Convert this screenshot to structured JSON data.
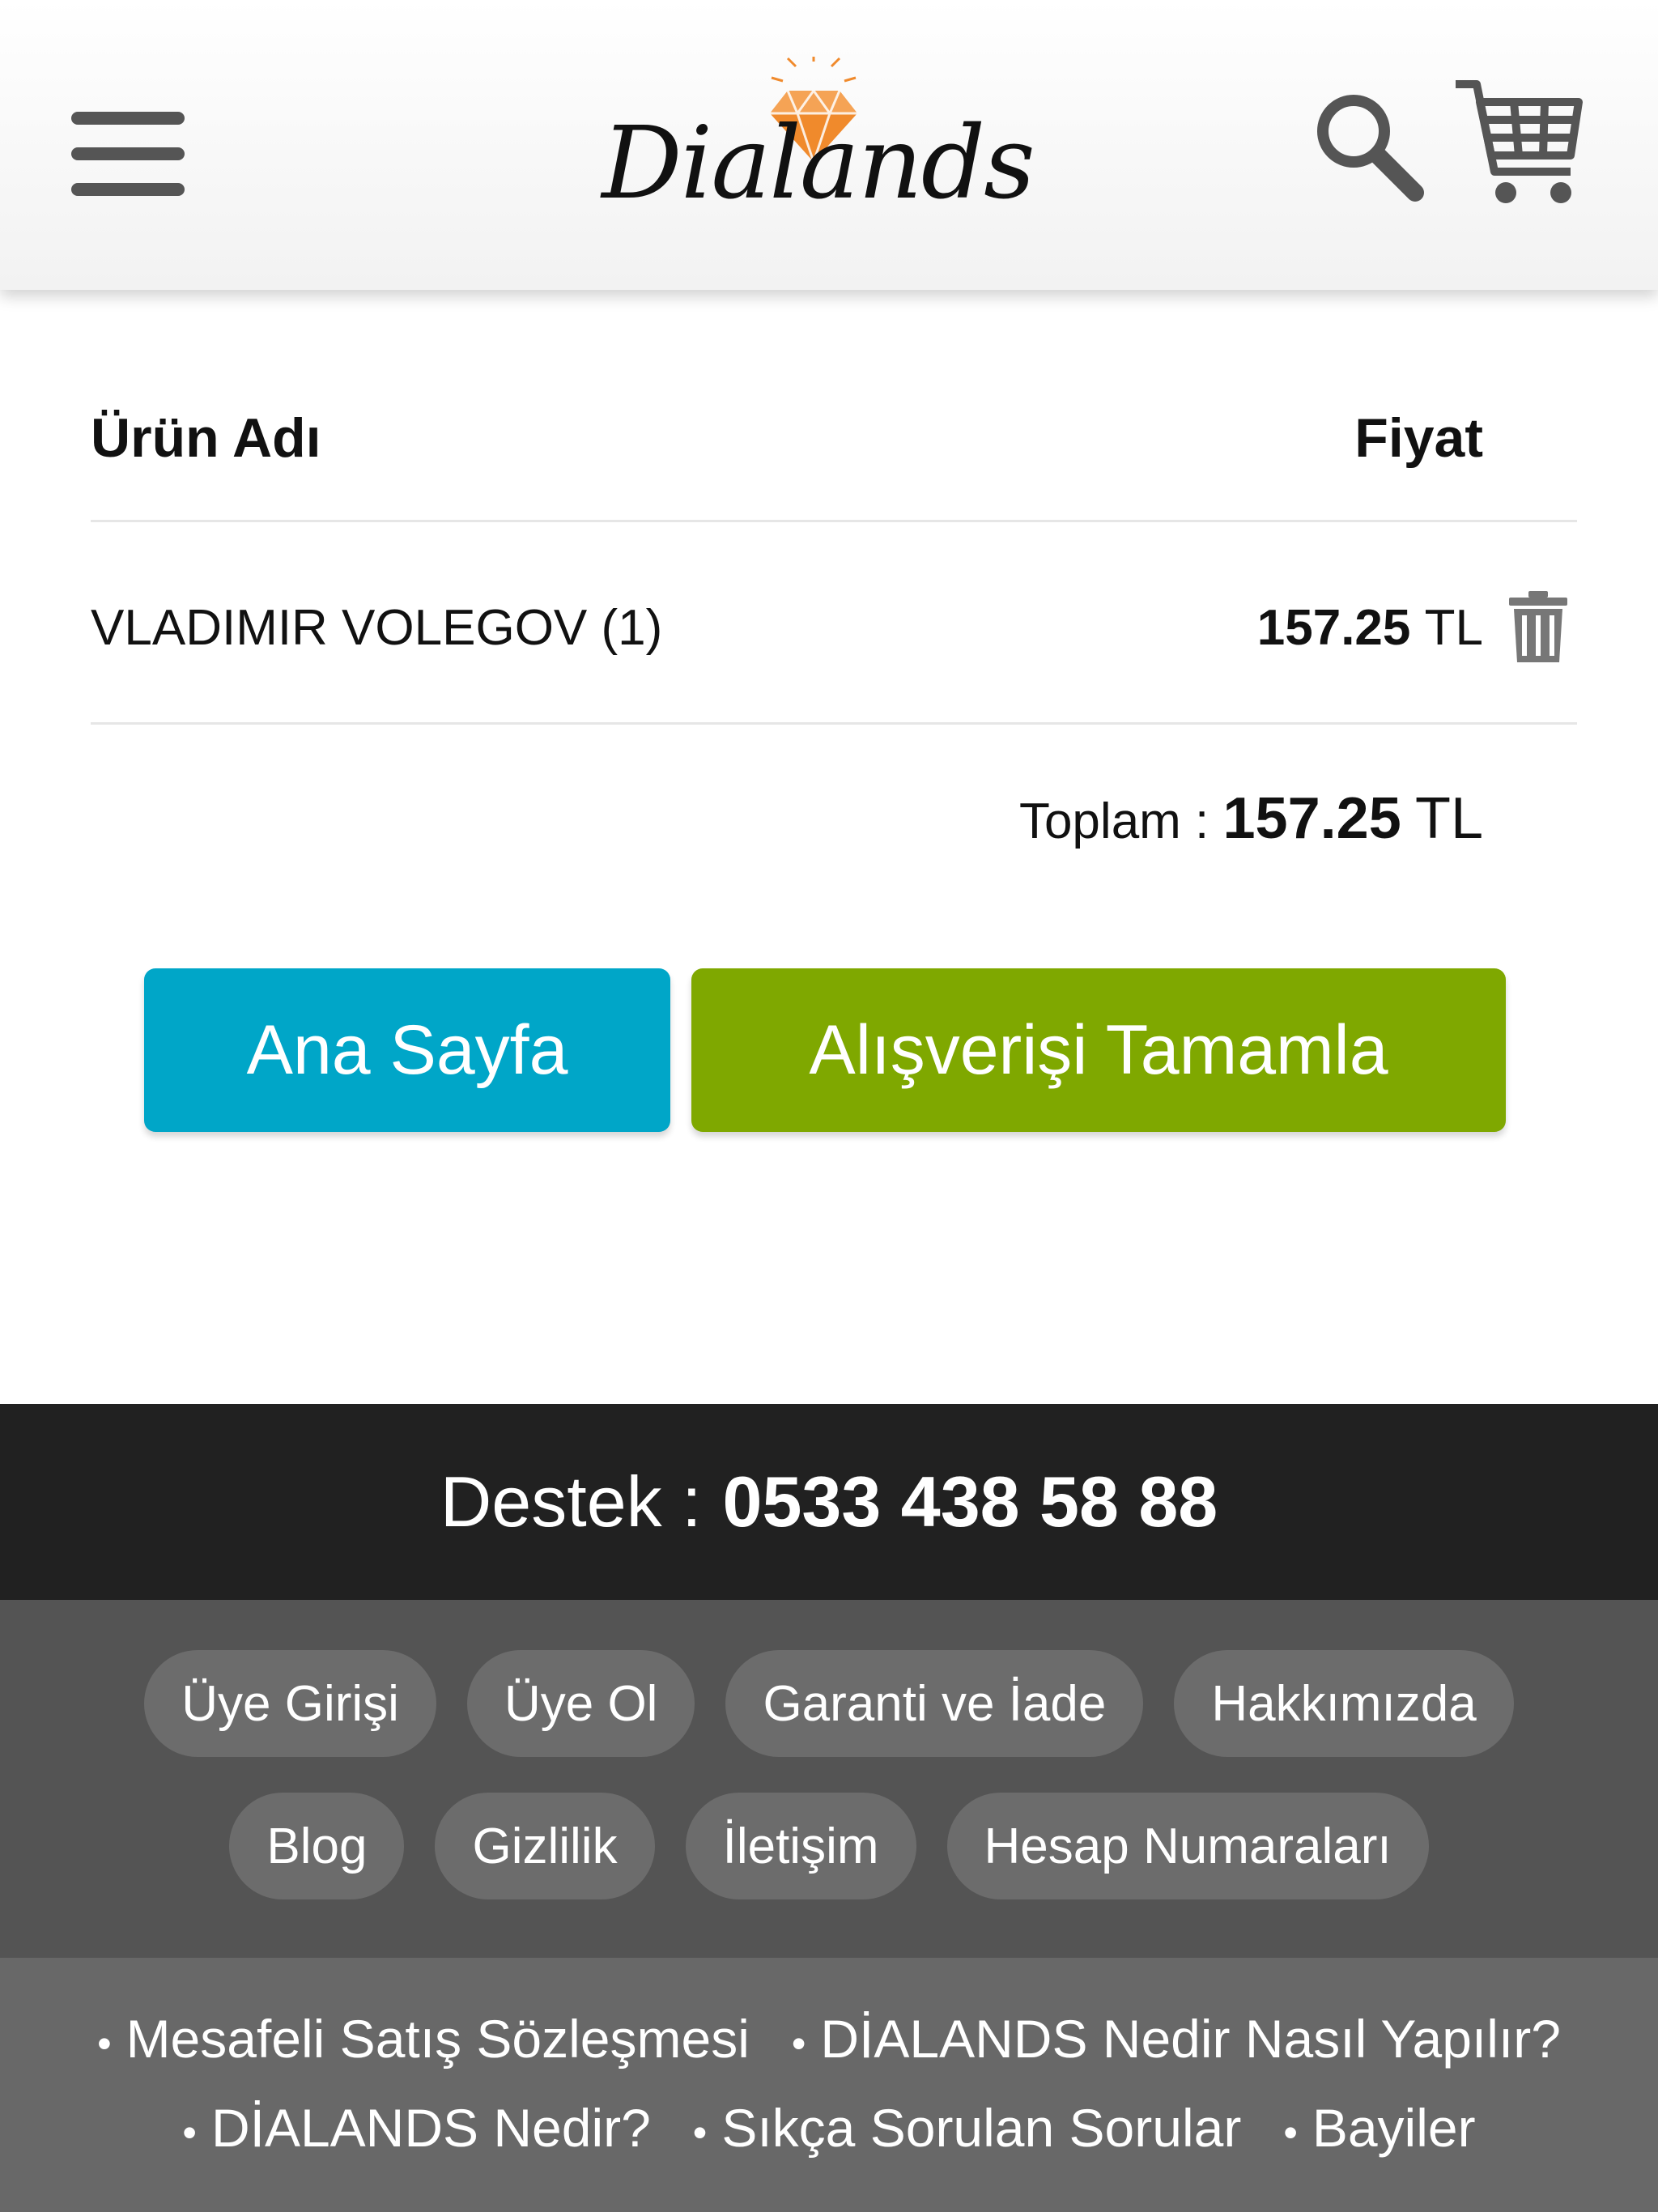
{
  "header": {
    "logo_text": "Dialands",
    "colors": {
      "logo_gem": "#f08a2c"
    }
  },
  "cart": {
    "col_name": "Ürün Adı",
    "col_price": "Fiyat",
    "items": [
      {
        "name": "VLADIMIR VOLEGOV (1)",
        "price": "157.25",
        "currency": "TL"
      }
    ],
    "total_label": "Toplam :",
    "total_value": "157.25",
    "total_currency": "TL"
  },
  "buttons": {
    "home": "Ana Sayfa",
    "checkout": "Alışverişi Tamamla",
    "colors": {
      "home": "#00a6c8",
      "checkout": "#7fa800"
    }
  },
  "footer": {
    "support_label": "Destek :",
    "support_phone": "0533 438 58 88",
    "pills": [
      "Üye Girişi",
      "Üye Ol",
      "Garanti ve İade",
      "Hakkımızda",
      "Blog",
      "Gizlilik",
      "İletişim",
      "Hesap Numaraları"
    ],
    "links": [
      "Mesafeli Satış Sözleşmesi",
      "DİALANDS Nedir Nasıl Yapılır?",
      "DİALANDS Nedir?",
      "Sıkça Sorulan Sorular",
      "Bayiler"
    ]
  }
}
